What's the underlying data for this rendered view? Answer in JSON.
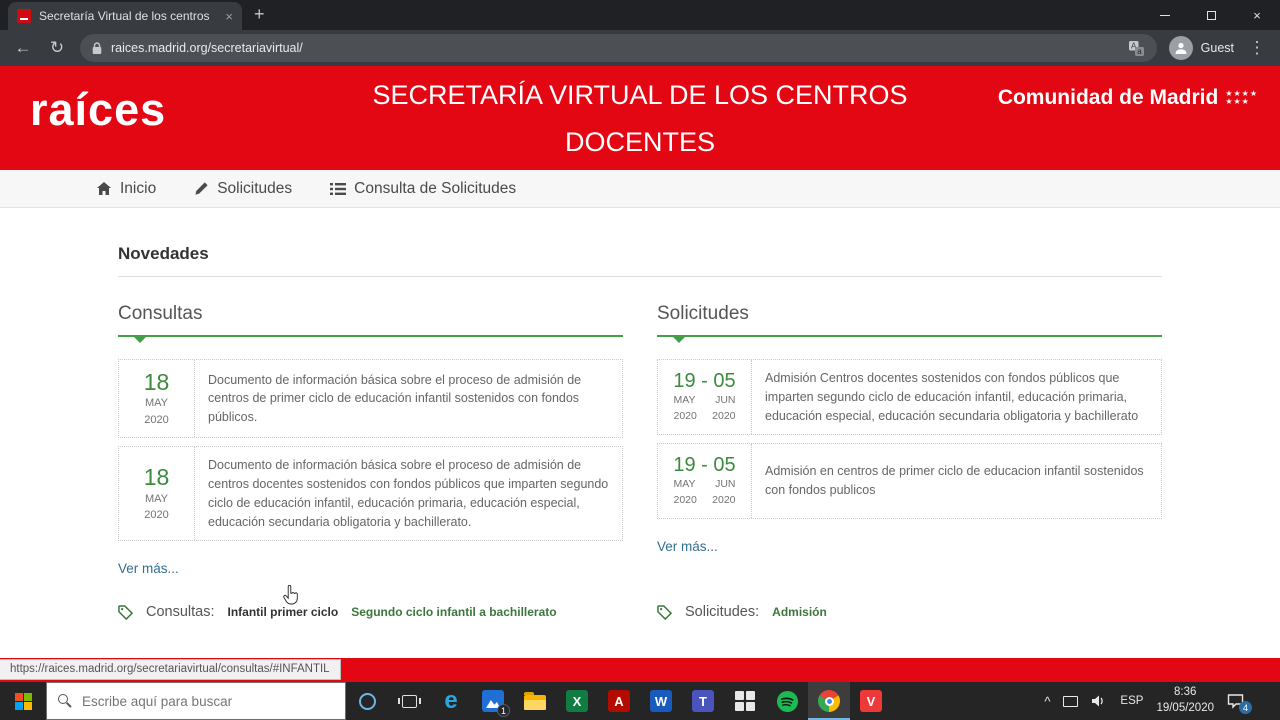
{
  "browser": {
    "tab_title": "Secretaría Virtual de los centros",
    "url": "raices.madrid.org/secretariavirtual/",
    "profile_label": "Guest",
    "status_url": "https://raices.madrid.org/secretariavirtual/consultas/#INFANTIL"
  },
  "icons": {
    "back": "←",
    "reload": "↻",
    "menu": "⋮",
    "tab_close": "×",
    "new_tab": "+",
    "win_close": "×",
    "tray_chevron": "^",
    "translate_front": "A",
    "translate_back": "a",
    "edge": "e",
    "excel": "X",
    "acrobat": "A",
    "word": "W",
    "teams": "T",
    "vivaldi": "V"
  },
  "header": {
    "logo": "raíces",
    "title_line1": "SECRETARÍA VIRTUAL DE LOS CENTROS",
    "title_line2": "DOCENTES",
    "brand": "Comunidad de Madrid",
    "stars_row1": "★★★★",
    "stars_row2": "★★★"
  },
  "nav": {
    "inicio": "Inicio",
    "solicitudes": "Solicitudes",
    "consulta": "Consulta de Solicitudes"
  },
  "main": {
    "heading": "Novedades",
    "consultas": {
      "title": "Consultas",
      "items": [
        {
          "day": "18",
          "month": "MAY",
          "year": "2020",
          "text": "Documento de información básica sobre el proceso de admisión de centros de primer ciclo de educación infantil sostenidos con fondos públicos."
        },
        {
          "day": "18",
          "month": "MAY",
          "year": "2020",
          "text": "Documento de información básica sobre el proceso de admisión de centros docentes sostenidos con fondos públicos que imparten segundo ciclo de educación infantil, educación primaria, educación especial, educación secundaria obligatoria y bachillerato."
        }
      ],
      "more": "Ver más..."
    },
    "solicitudes": {
      "title": "Solicitudes",
      "items": [
        {
          "days": "19 - 05",
          "month_start": "MAY",
          "month_end": "JUN",
          "year_start": "2020",
          "year_end": "2020",
          "text": "Admisión Centros docentes sostenidos con fondos públicos que imparten segundo ciclo de educación infantil, educación primaria, educación especial, educación secundaria obligatoria y bachillerato"
        },
        {
          "days": "19 - 05",
          "month_start": "MAY",
          "month_end": "JUN",
          "year_start": "2020",
          "year_end": "2020",
          "text": "Admisión en centros de primer ciclo de educacion infantil sostenidos con fondos publicos"
        }
      ],
      "more": "Ver más..."
    },
    "tags": {
      "consultas_label": "Consultas:",
      "consultas_link1": "Infantil primer ciclo",
      "consultas_link2": "Segundo ciclo infantil a bachillerato",
      "solicitudes_label": "Solicitudes:",
      "solicitudes_link1": "Admisión"
    }
  },
  "taskbar": {
    "search_placeholder": "Escribe aquí para buscar",
    "badge_mail": "1",
    "lang": "ESP",
    "time": "8:36",
    "date": "19/05/2020",
    "badge_notifications": "4"
  },
  "colors": {
    "brand_red": "#e30613",
    "date_green": "#3c8a3c",
    "underline_green": "#43a047",
    "link_teal": "#31708f",
    "tag_green": "#3c763d"
  }
}
